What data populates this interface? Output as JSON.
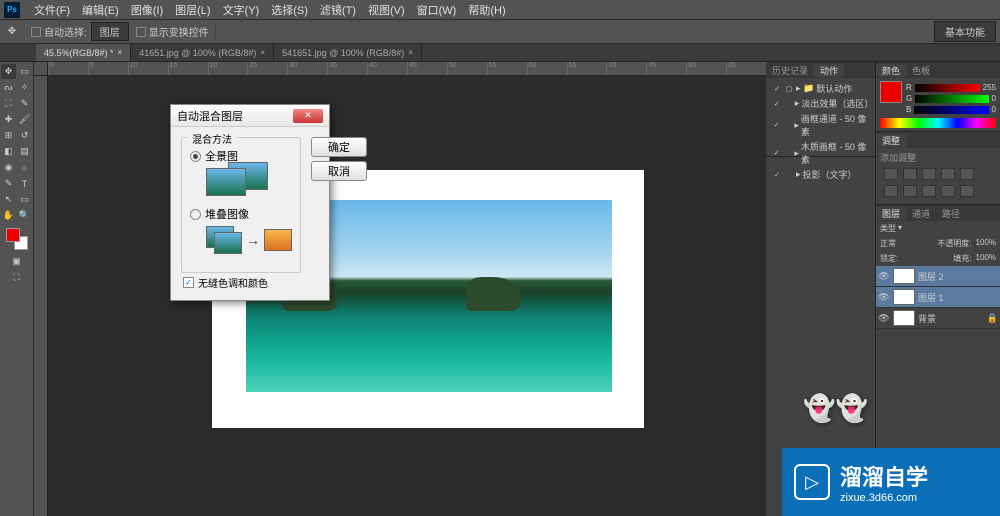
{
  "menubar": {
    "items": [
      "文件(F)",
      "编辑(E)",
      "图像(I)",
      "图层(L)",
      "文字(Y)",
      "选择(S)",
      "滤镜(T)",
      "视图(V)",
      "窗口(W)",
      "帮助(H)"
    ]
  },
  "optionsbar": {
    "autoselect_label": "自动选择:",
    "autoselect_value": "图层",
    "show_controls_label": "显示变换控件",
    "workspace": "基本功能"
  },
  "doctabs": [
    {
      "label": "45.5%(RGB/8#) *",
      "active": true
    },
    {
      "label": "41651.jpg @ 100% (RGB/8#)",
      "active": false
    },
    {
      "label": "541651.jpg @ 100% (RGB/8#)",
      "active": false
    }
  ],
  "ruler_marks": [
    "0",
    "5",
    "10",
    "15",
    "20",
    "25",
    "30",
    "35",
    "40",
    "45",
    "50",
    "55",
    "60",
    "65",
    "70",
    "75",
    "80",
    "85"
  ],
  "actions_panel": {
    "tabs": [
      "历史记录",
      "动作"
    ],
    "folder": "默认动作",
    "items": [
      "淡出效果（选区）",
      "画框通道 - 50 像素",
      "木质画框 - 50 像素",
      "投影（文字）"
    ]
  },
  "color_panel": {
    "tabs": [
      "颜色",
      "色板"
    ],
    "r": "255",
    "g": "0",
    "b": "0"
  },
  "adjustments_panel": {
    "tab": "调整",
    "label": "添加调整"
  },
  "layers_panel": {
    "tabs": [
      "图层",
      "通道",
      "路径"
    ],
    "kind": "类型",
    "mode": "正常",
    "opacity_label": "不透明度:",
    "opacity": "100%",
    "lock_label": "锁定:",
    "fill_label": "填充:",
    "fill": "100%",
    "layers": [
      {
        "name": "图层 2",
        "selected": true
      },
      {
        "name": "图层 1",
        "selected": false
      },
      {
        "name": "背景",
        "selected": false,
        "locked": true
      }
    ]
  },
  "dialog": {
    "title": "自动混合图层",
    "group_legend": "混合方法",
    "radio_panorama": "全景图",
    "radio_stack": "堆叠图像",
    "checkbox_seamless": "无缝色调和颜色",
    "ok": "确定",
    "cancel": "取消"
  },
  "watermark": {
    "title": "溜溜自学",
    "url": "zixue.3d66.com"
  }
}
